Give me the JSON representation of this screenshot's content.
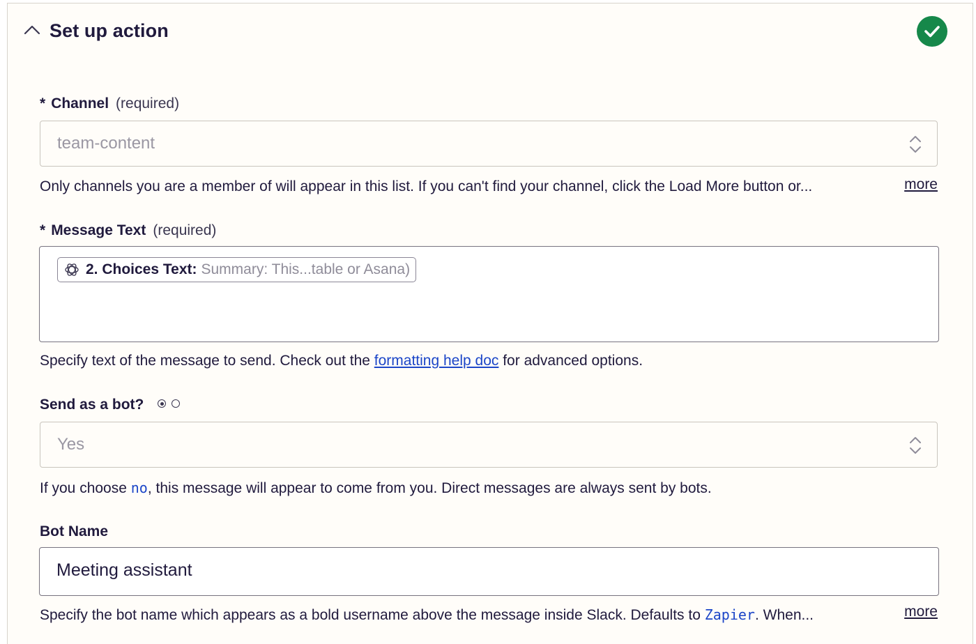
{
  "section": {
    "title": "Set up action",
    "status_icon": "check-circle-icon",
    "status_color": "#16884a"
  },
  "channel": {
    "asterisk": "*",
    "label": "Channel",
    "required": "(required)",
    "value": "team-content",
    "help": "Only channels you are a member of will appear in this list. If you can't find your channel, click the Load More button or...",
    "more": "more"
  },
  "message": {
    "asterisk": "*",
    "label": "Message Text",
    "required": "(required)",
    "pill_icon": "openai-icon",
    "pill_label": "2. Choices Text:",
    "pill_value": "Summary: This...table or Asana)",
    "help_before": "Specify text of the message to send. Check out the ",
    "help_link": "formatting help doc",
    "help_after": " for advanced options."
  },
  "bot": {
    "label": "Send as a bot?",
    "value": "Yes",
    "help_before": "If you choose ",
    "help_code": "no",
    "help_after": ", this message will appear to come from you. Direct messages are always sent by bots."
  },
  "bot_name": {
    "label": "Bot Name",
    "value": "Meeting assistant",
    "help_before": "Specify the bot name which appears as a bold username above the message inside Slack. Defaults to ",
    "help_code": "Zapier",
    "help_after": ". When...",
    "more": "more"
  }
}
